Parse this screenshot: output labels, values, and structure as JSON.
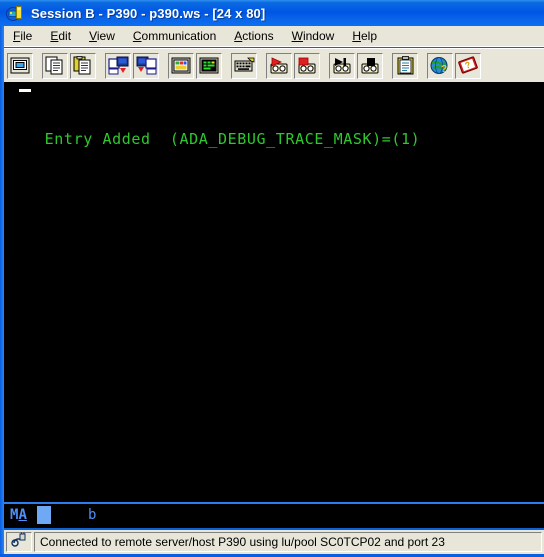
{
  "window": {
    "title": "Session B - P390 - p390.ws - [24 x 80]",
    "icon": "terminal-session-icon",
    "titlebar_color": "#0055e5"
  },
  "menubar": {
    "items": [
      {
        "label": "File",
        "accel": "F"
      },
      {
        "label": "Edit",
        "accel": "E"
      },
      {
        "label": "View",
        "accel": "V"
      },
      {
        "label": "Communication",
        "accel": "C"
      },
      {
        "label": "Actions",
        "accel": "A"
      },
      {
        "label": "Window",
        "accel": "W"
      },
      {
        "label": "Help",
        "accel": "H"
      }
    ]
  },
  "toolbar": {
    "groups": [
      {
        "buttons": [
          {
            "name": "display-settings-icon",
            "tooltip": "Display Setup"
          }
        ]
      },
      {
        "buttons": [
          {
            "name": "copy-icon",
            "tooltip": "Copy"
          },
          {
            "name": "paste-icon",
            "tooltip": "Paste"
          }
        ]
      },
      {
        "buttons": [
          {
            "name": "send-file-icon",
            "tooltip": "Send File to Host"
          },
          {
            "name": "receive-file-icon",
            "tooltip": "Receive File from Host"
          }
        ]
      },
      {
        "buttons": [
          {
            "name": "color-settings-icon",
            "tooltip": "Color Setup"
          },
          {
            "name": "screen-settings-icon",
            "tooltip": "Screen Setup"
          }
        ]
      },
      {
        "buttons": [
          {
            "name": "keyboard-setup-icon",
            "tooltip": "Keyboard Setup"
          }
        ]
      },
      {
        "buttons": [
          {
            "name": "record-macro-icon",
            "tooltip": "Record Macro"
          },
          {
            "name": "stop-record-icon",
            "tooltip": "Stop Recording"
          }
        ]
      },
      {
        "buttons": [
          {
            "name": "play-macro-icon",
            "tooltip": "Play Macro"
          },
          {
            "name": "stop-macro-icon",
            "tooltip": "Stop Macro"
          }
        ]
      },
      {
        "buttons": [
          {
            "name": "clipboard-icon",
            "tooltip": "Clipboard"
          }
        ]
      },
      {
        "buttons": [
          {
            "name": "globe-help-icon",
            "tooltip": "Web Help"
          },
          {
            "name": "help-book-icon",
            "tooltip": "Help Index"
          }
        ]
      }
    ]
  },
  "terminal": {
    "rows": 24,
    "cols": 80,
    "background": "#000000",
    "foreground": "#2ec82e",
    "cursor_style": "underline-block",
    "cursor_color": "#ffffff",
    "lines": [
      "Entry Added  (ADA_DEBUG_TRACE_MASK)=(1)"
    ]
  },
  "oia": {
    "connection_indicator": "MA",
    "connection_underline": "A",
    "cursor_block": "filled-block",
    "field_indicator": "b",
    "text_color": "#4f8ff7",
    "block_color": "#6fa8f5"
  },
  "statusbar": {
    "icon": "connection-plug-icon",
    "message": "Connected to remote server/host P390 using lu/pool SC0TCP02 and port 23"
  }
}
